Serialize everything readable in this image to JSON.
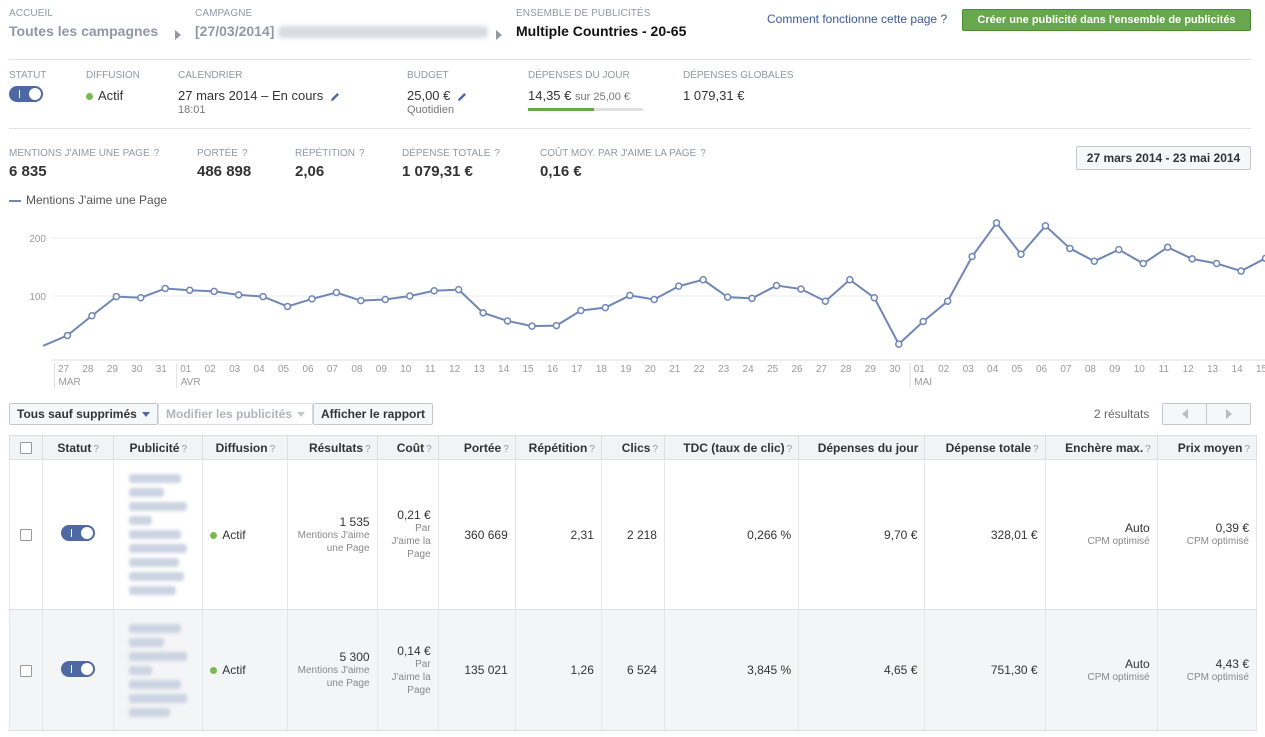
{
  "breadcrumb": {
    "home_label": "ACCUEIL",
    "home_value": "Toutes les campagnes",
    "campaign_label": "CAMPAGNE",
    "campaign_value": "[27/03/2014]",
    "adset_label": "ENSEMBLE DE PUBLICITÉS",
    "adset_value": "Multiple Countries - 20-65"
  },
  "header": {
    "help_link": "Comment fonctionne cette page ?",
    "create_button": "Créer une publicité dans l'ensemble de publicités"
  },
  "status_row": {
    "status_label": "STATUT",
    "delivery_label": "DIFFUSION",
    "delivery_value": "Actif",
    "schedule_label": "CALENDRIER",
    "schedule_value": "27 mars 2014 – En cours",
    "schedule_time": "18:01",
    "budget_label": "BUDGET",
    "budget_value": "25,00 €",
    "budget_type": "Quotidien",
    "daily_spend_label": "DÉPENSES DU JOUR",
    "daily_spend_value": "14,35 €",
    "daily_spend_of": "sur 25,00 €",
    "daily_spend_fraction": 0.574,
    "total_spend_label": "DÉPENSES GLOBALES",
    "total_spend_value": "1 079,31 €"
  },
  "metrics": {
    "likes_label": "MENTIONS J'AIME UNE PAGE",
    "likes_value": "6 835",
    "reach_label": "PORTÉE",
    "reach_value": "486 898",
    "frequency_label": "RÉPÉTITION",
    "frequency_value": "2,06",
    "total_spent_label": "DÉPENSE TOTALE",
    "total_spent_value": "1 079,31 €",
    "cost_per_like_label": "COÛT MOY. PAR J'AIME LA PAGE",
    "cost_per_like_value": "0,16 €",
    "help_mark": "?",
    "date_range": "27 mars 2014 - 23 mai 2014"
  },
  "chart_data": {
    "type": "line",
    "series": [
      {
        "name": "Mentions J'aime une Page",
        "color": "#6f86b6",
        "values": [
          14,
          32,
          66,
          99,
          97,
          113,
          110,
          108,
          102,
          99,
          82,
          95,
          106,
          92,
          94,
          100,
          109,
          111,
          71,
          57,
          48,
          49,
          75,
          80,
          101,
          94,
          117,
          128,
          98,
          96,
          118,
          112,
          91,
          128,
          97,
          17,
          56,
          91,
          168,
          226,
          172,
          221,
          182,
          160,
          180,
          156,
          184,
          164,
          156,
          143,
          165,
          158
        ]
      }
    ],
    "x_ticks": [
      "27",
      "28",
      "29",
      "30",
      "31",
      "01",
      "02",
      "03",
      "04",
      "05",
      "06",
      "07",
      "08",
      "09",
      "10",
      "11",
      "12",
      "13",
      "14",
      "15",
      "16",
      "17",
      "18",
      "19",
      "20",
      "21",
      "22",
      "23",
      "24",
      "25",
      "26",
      "27",
      "28",
      "29",
      "30",
      "01",
      "02",
      "03",
      "04",
      "05",
      "06",
      "07",
      "08",
      "09",
      "10",
      "11",
      "12",
      "13",
      "14",
      "15"
    ],
    "month_labels": [
      {
        "label": "MAR",
        "tick_index": 0
      },
      {
        "label": "AVR",
        "tick_index": 5
      },
      {
        "label": "MAI",
        "tick_index": 35
      }
    ],
    "y_ticks": [
      100,
      200
    ],
    "ylim": [
      0,
      240
    ],
    "grid": true
  },
  "toolbar": {
    "filter_button": "Tous sauf supprimés",
    "edit_button": "Modifier les publicités",
    "report_button": "Afficher le rapport",
    "results_count": "2 résultats"
  },
  "table": {
    "columns": [
      "Statut",
      "Publicité",
      "Diffusion",
      "Résultats",
      "Coût",
      "Portée",
      "Répétition",
      "Clics",
      "TDC (taux de clic)",
      "Dépenses du jour",
      "Dépense totale",
      "Enchère max.",
      "Prix moyen"
    ],
    "help_mark": "?",
    "rows": [
      {
        "delivery": "Actif",
        "results": "1 535",
        "results_sub": "Mentions J'aime une Page",
        "cost": "0,21 €",
        "cost_sub": "Par J'aime la Page",
        "reach": "360 669",
        "frequency": "2,31",
        "clicks": "2 218",
        "ctr": "0,266 %",
        "daily_spend": "9,70 €",
        "total_spend": "328,01 €",
        "max_bid": "Auto",
        "max_bid_sub": "CPM optimisé",
        "avg_price": "0,39 €",
        "avg_price_sub": "CPM optimisé"
      },
      {
        "delivery": "Actif",
        "results": "5 300",
        "results_sub": "Mentions J'aime une Page",
        "cost": "0,14 €",
        "cost_sub": "Par J'aime la Page",
        "reach": "135 021",
        "frequency": "1,26",
        "clicks": "6 524",
        "ctr": "3,845 %",
        "daily_spend": "4,65 €",
        "total_spend": "751,30 €",
        "max_bid": "Auto",
        "max_bid_sub": "CPM optimisé",
        "avg_price": "4,43 €",
        "avg_price_sub": "CPM optimisé"
      }
    ]
  },
  "colors": {
    "accent_blue": "#4e69a2",
    "link_blue": "#3b5998",
    "create_green": "#69a74e",
    "active_dot": "#7bbb4d"
  }
}
